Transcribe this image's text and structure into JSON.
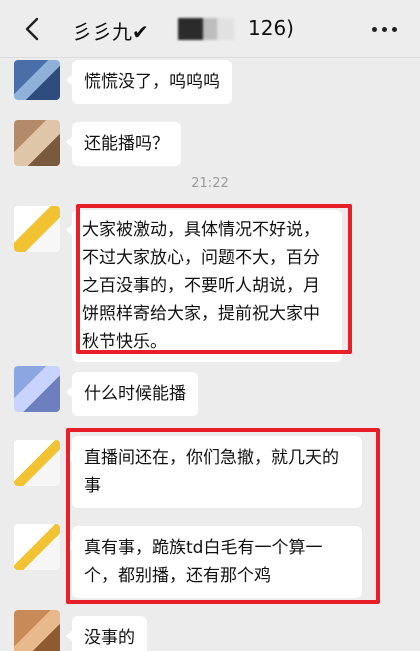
{
  "header": {
    "title_prefix": "彡彡九✔",
    "title_suffix": "126)",
    "back_icon": "chevron-left-icon",
    "more_icon": "more-dots-icon"
  },
  "messages": [
    {
      "text": "慌慌没了，呜呜呜"
    },
    {
      "text": "还能播吗？"
    },
    {
      "text": "大家被激动，具体情况不好说，不过大家放心，问题不大，百分之百没事的，不要听人胡说，月饼照样寄给大家，提前祝大家中秋节快乐。"
    },
    {
      "text": "什么时候能播"
    },
    {
      "text": "直播间还在，你们急撤，就几天的事"
    },
    {
      "text": "真有事，跪族td白毛有一个算一个，都别播，还有那个鸡"
    },
    {
      "text": "没事的"
    }
  ],
  "timestamp": "21:22",
  "colors": {
    "highlight": "#e8202a",
    "background": "#ececec",
    "bubble": "#ffffff"
  }
}
